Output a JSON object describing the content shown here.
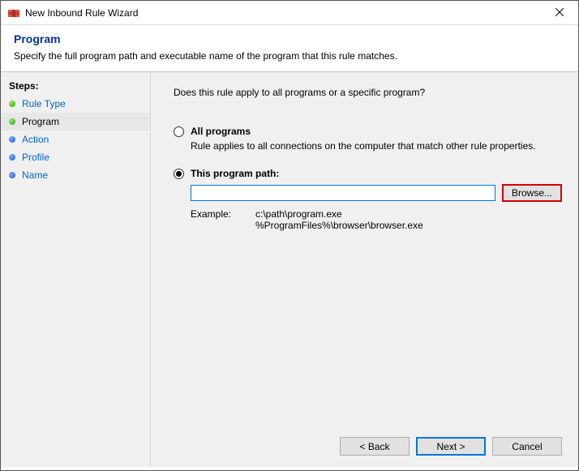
{
  "window": {
    "title": "New Inbound Rule Wizard"
  },
  "header": {
    "title": "Program",
    "subtitle": "Specify the full program path and executable name of the program that this rule matches."
  },
  "sidebar": {
    "title": "Steps:",
    "items": [
      {
        "label": "Rule Type"
      },
      {
        "label": "Program"
      },
      {
        "label": "Action"
      },
      {
        "label": "Profile"
      },
      {
        "label": "Name"
      }
    ]
  },
  "main": {
    "question": "Does this rule apply to all programs or a specific program?",
    "option_all": {
      "title": "All programs",
      "desc": "Rule applies to all connections on the computer that match other rule properties."
    },
    "option_path": {
      "title": "This program path:",
      "value": "",
      "browse_label": "Browse...",
      "example_label": "Example:",
      "example_text": "c:\\path\\program.exe\n%ProgramFiles%\\browser\\browser.exe"
    }
  },
  "buttons": {
    "back": "< Back",
    "next": "Next >",
    "cancel": "Cancel"
  }
}
